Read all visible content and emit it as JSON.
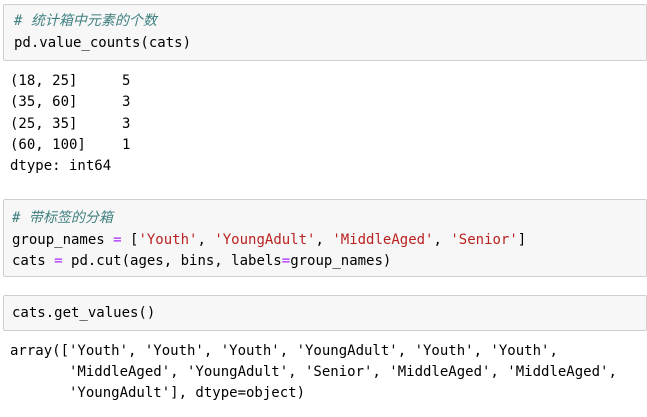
{
  "cell1": {
    "comment": "# 统计箱中元素的个数",
    "code": "pd.value_counts(cats)"
  },
  "output1": {
    "rows": [
      {
        "label": "(18, 25]",
        "count": "5"
      },
      {
        "label": "(35, 60]",
        "count": "3"
      },
      {
        "label": "(25, 35]",
        "count": "3"
      },
      {
        "label": "(60, 100]",
        "count": "1"
      }
    ],
    "dtype": "dtype: int64"
  },
  "cell2": {
    "comment": "# 带标签的分箱",
    "line1_var": "group_names ",
    "line1_op": "=",
    "line1_open": " [",
    "names": [
      "'Youth'",
      "'YoungAdult'",
      "'MiddleAged'",
      "'Senior'"
    ],
    "line1_close": "]",
    "line2_var": "cats ",
    "line2_op": "=",
    "line2_rest_a": " pd.cut(ages, bins, labels",
    "line2_op2": "=",
    "line2_rest_b": "group_names)"
  },
  "cell3": {
    "code": "cats.get_values()"
  },
  "output3": {
    "lines": [
      "array(['Youth', 'Youth', 'Youth', 'YoungAdult', 'Youth', 'Youth',",
      "       'MiddleAged', 'YoungAdult', 'Senior', 'MiddleAged', 'MiddleAged',",
      "       'YoungAdult'], dtype=object)"
    ]
  }
}
